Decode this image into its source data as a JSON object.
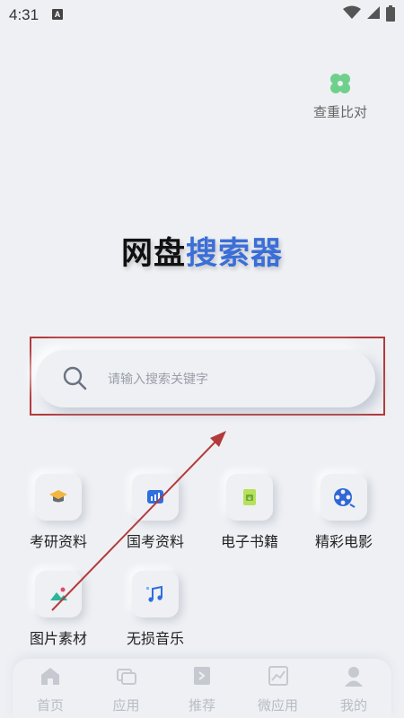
{
  "status_bar": {
    "time": "4:31",
    "notification_badge": "A"
  },
  "header": {
    "compare_label": "查重比对",
    "compare_icon": "clover-icon",
    "accent_color": "#6fd08c"
  },
  "title": {
    "part1": "网盘",
    "part2": "搜索器",
    "dark_color": "#111111",
    "blue_color": "#3a6ed8"
  },
  "search": {
    "placeholder": "请输入搜索关键字",
    "value": ""
  },
  "categories": [
    {
      "label": "考研资料",
      "icon": "graduation-cap-icon"
    },
    {
      "label": "国考资料",
      "icon": "bar-chart-icon"
    },
    {
      "label": "电子书籍",
      "icon": "ebook-icon"
    },
    {
      "label": "精彩电影",
      "icon": "film-reel-icon"
    },
    {
      "label": "图片素材",
      "icon": "image-icon"
    },
    {
      "label": "无损音乐",
      "icon": "music-note-icon"
    }
  ],
  "tabs": [
    {
      "label": "首页",
      "icon": "home-icon"
    },
    {
      "label": "应用",
      "icon": "apps-icon"
    },
    {
      "label": "推荐",
      "icon": "recommend-icon"
    },
    {
      "label": "微应用",
      "icon": "chart-icon"
    },
    {
      "label": "我的",
      "icon": "user-icon"
    }
  ],
  "annotation_color": "#b33a3a"
}
